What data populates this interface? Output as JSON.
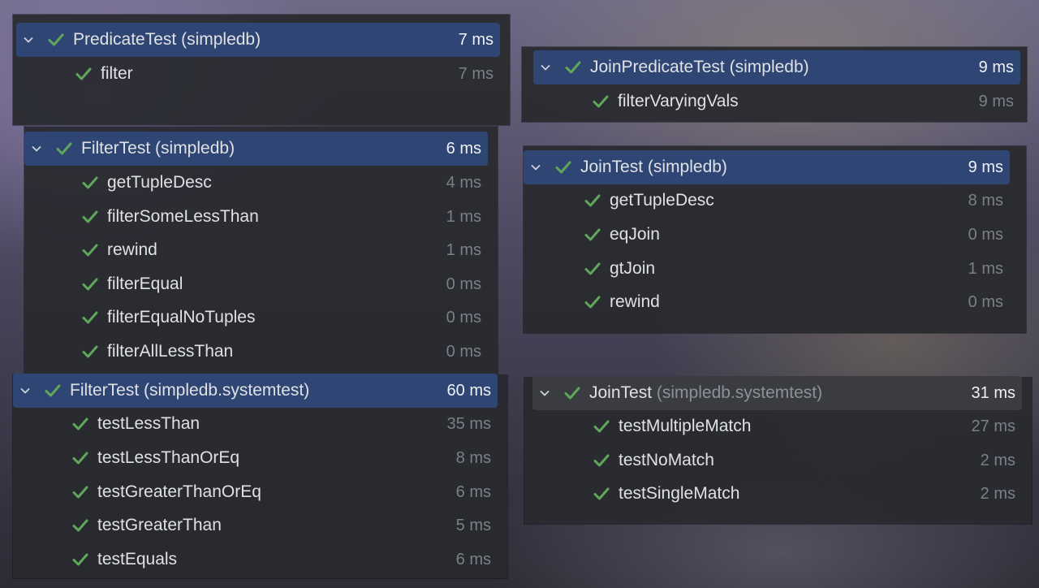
{
  "panels": [
    {
      "header": {
        "name": "PredicateTest",
        "package": "(simpledb)",
        "time": "7 ms"
      },
      "tests": [
        {
          "name": "filter",
          "time": "7 ms"
        }
      ]
    },
    {
      "header": {
        "name": "JoinPredicateTest",
        "package": "(simpledb)",
        "time": "9 ms"
      },
      "tests": [
        {
          "name": "filterVaryingVals",
          "time": "9 ms"
        }
      ]
    },
    {
      "header": {
        "name": "FilterTest",
        "package": "(simpledb)",
        "time": "6 ms"
      },
      "tests": [
        {
          "name": "getTupleDesc",
          "time": "4 ms"
        },
        {
          "name": "filterSomeLessThan",
          "time": "1 ms"
        },
        {
          "name": "rewind",
          "time": "1 ms"
        },
        {
          "name": "filterEqual",
          "time": "0 ms"
        },
        {
          "name": "filterEqualNoTuples",
          "time": "0 ms"
        },
        {
          "name": "filterAllLessThan",
          "time": "0 ms"
        }
      ]
    },
    {
      "header": {
        "name": "JoinTest",
        "package": "(simpledb)",
        "time": "9 ms"
      },
      "tests": [
        {
          "name": "getTupleDesc",
          "time": "8 ms"
        },
        {
          "name": "eqJoin",
          "time": "0 ms"
        },
        {
          "name": "gtJoin",
          "time": "1 ms"
        },
        {
          "name": "rewind",
          "time": "0 ms"
        }
      ]
    },
    {
      "header": {
        "name": "FilterTest",
        "package": "(simpledb.systemtest)",
        "time": "60 ms"
      },
      "tests": [
        {
          "name": "testLessThan",
          "time": "35 ms"
        },
        {
          "name": "testLessThanOrEq",
          "time": "8 ms"
        },
        {
          "name": "testGreaterThanOrEq",
          "time": "6 ms"
        },
        {
          "name": "testGreaterThan",
          "time": "5 ms"
        },
        {
          "name": "testEquals",
          "time": "6 ms"
        }
      ]
    },
    {
      "header": {
        "name": "JoinTest",
        "package": "(simpledb.systemtest)",
        "time": "31 ms"
      },
      "tests": [
        {
          "name": "testMultipleMatch",
          "time": "27 ms"
        },
        {
          "name": "testNoMatch",
          "time": "2 ms"
        },
        {
          "name": "testSingleMatch",
          "time": "2 ms"
        }
      ]
    }
  ],
  "colors": {
    "pass_check": "#5fa85a",
    "header_selected": "#2f4674",
    "header_unselected": "#3a3c41",
    "panel_bg": "#282a2e"
  },
  "icons": {
    "expand": "chevron-down-icon",
    "status": "checkmark-icon"
  }
}
